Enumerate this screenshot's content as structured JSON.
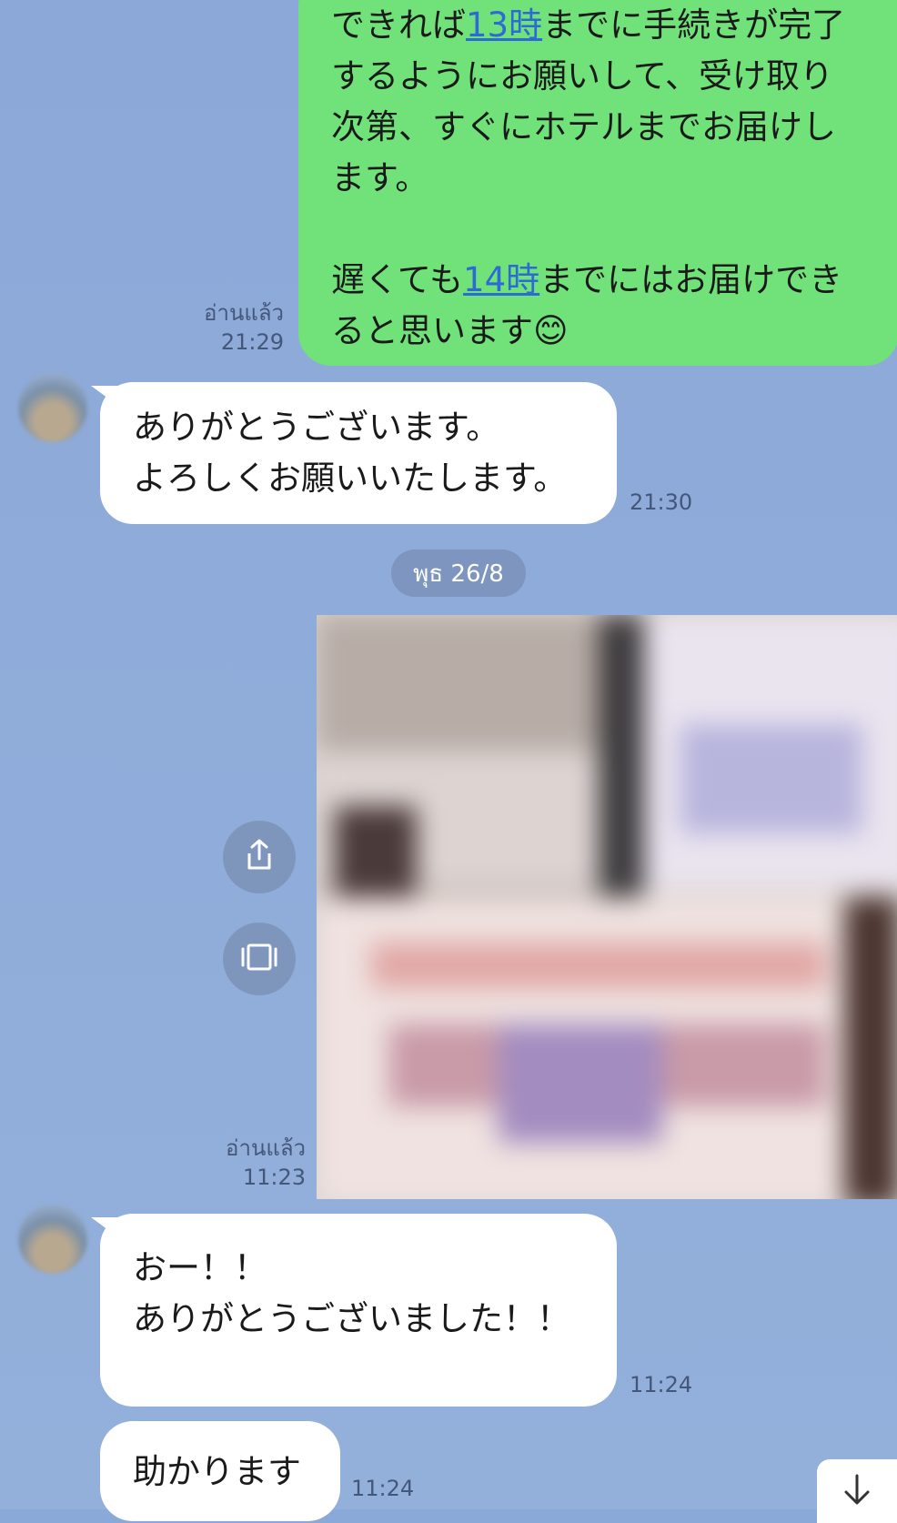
{
  "chat": {
    "messages": [
      {
        "lines": [
          "できれば",
          "13時",
          "までに手続きが完了",
          "するようにお願いして、受け取り",
          "次第、すぐにホテルまでお届けし",
          "ます。",
          "遅くても",
          "14時",
          "までにはお届けでき",
          "ると思います",
          "😊"
        ],
        "read_label": "อ่านแล้ว",
        "time": "21:29"
      },
      {
        "lines": [
          "ありがとうございます。",
          "よろしくお願いいたします。"
        ],
        "time": "21:30"
      },
      {
        "date": "พุธ 26/8"
      },
      {
        "read_label": "อ่านแล้ว",
        "time": "11:23"
      },
      {
        "lines": [
          "おー！！",
          "ありがとうございました！！"
        ],
        "time": "11:24"
      },
      {
        "lines": [
          "助かります"
        ],
        "time": "11:24"
      }
    ]
  },
  "icons": {
    "share": "share-icon",
    "gallery": "gallery-icon",
    "scroll_down": "arrow-down-icon"
  },
  "colors": {
    "background": "#8aa8d8",
    "outgoing_bubble": "#71e27a",
    "incoming_bubble": "#ffffff",
    "link": "#2c6bd6"
  }
}
